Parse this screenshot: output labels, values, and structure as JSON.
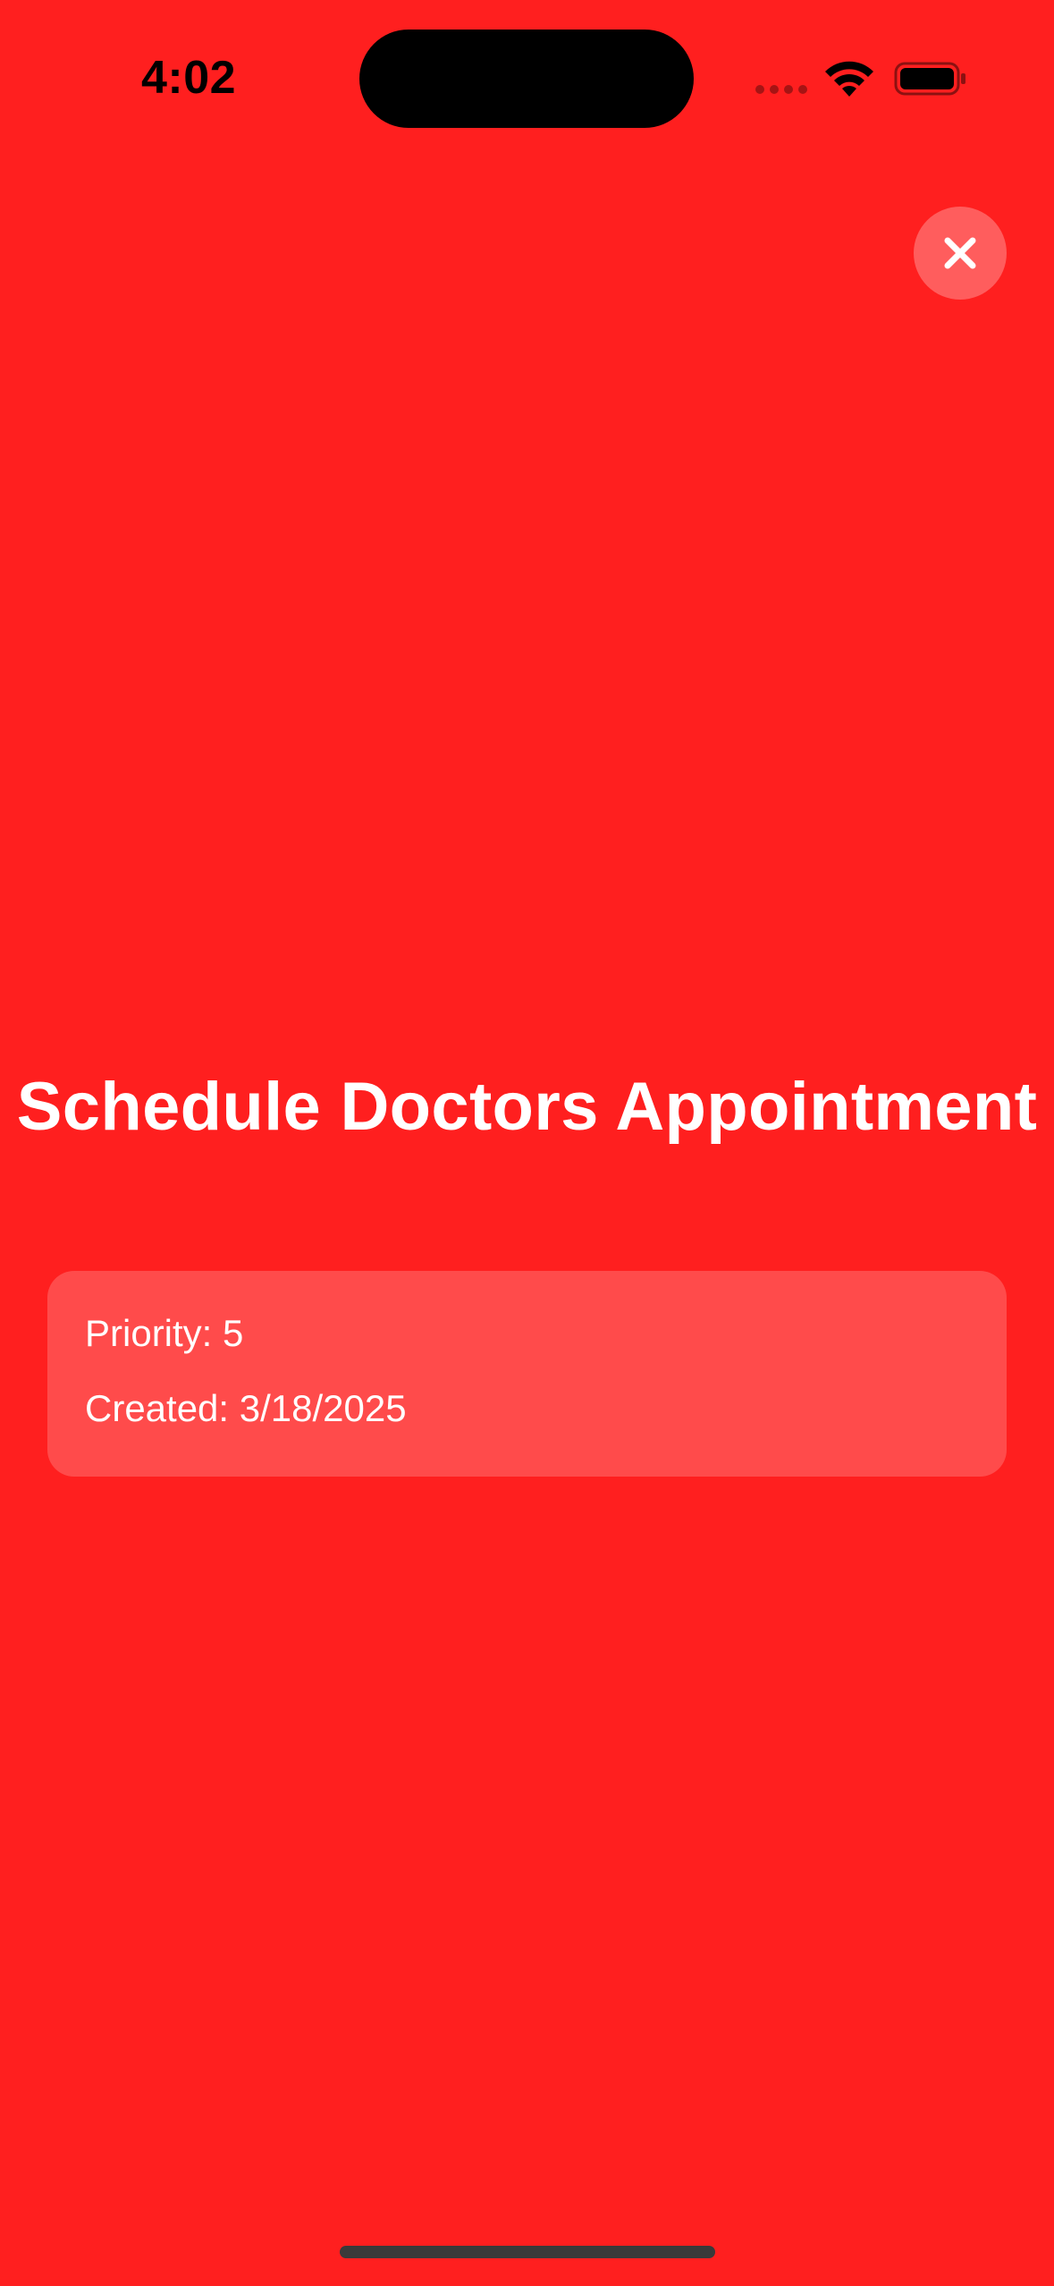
{
  "status_bar": {
    "time": "4:02"
  },
  "icons": {
    "wifi": "wifi-icon",
    "battery": "battery-icon",
    "close": "close-icon"
  },
  "colors": {
    "background": "#FF1F1F",
    "text": "#FFFFFF"
  },
  "detail": {
    "title": "Schedule Doctors Appointment",
    "priority_text": "Priority: 5",
    "created_text": "Created: 3/18/2025"
  }
}
